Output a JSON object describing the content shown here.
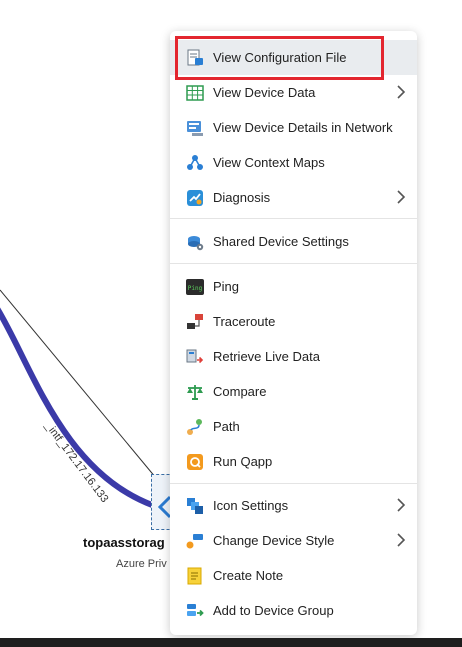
{
  "menu": {
    "items": [
      {
        "label": "View Configuration File"
      },
      {
        "label": "View Device Data"
      },
      {
        "label": "View Device Details in Network"
      },
      {
        "label": "View Context Maps"
      },
      {
        "label": "Diagnosis"
      },
      {
        "label": "Shared Device Settings"
      },
      {
        "label": "Ping"
      },
      {
        "label": "Traceroute"
      },
      {
        "label": "Retrieve Live Data"
      },
      {
        "label": "Compare"
      },
      {
        "label": "Path"
      },
      {
        "label": "Run Qapp"
      },
      {
        "label": "Icon Settings"
      },
      {
        "label": "Change Device Style"
      },
      {
        "label": "Create Note"
      },
      {
        "label": "Add to Device Group"
      }
    ]
  },
  "map": {
    "link_label": "_intf_172.17.16.133",
    "device_name": "topaasstorag",
    "device_subtitle": "Azure Priv"
  },
  "colors": {
    "highlight_border": "#e3262f",
    "link_thick": "#3b3aa8"
  }
}
